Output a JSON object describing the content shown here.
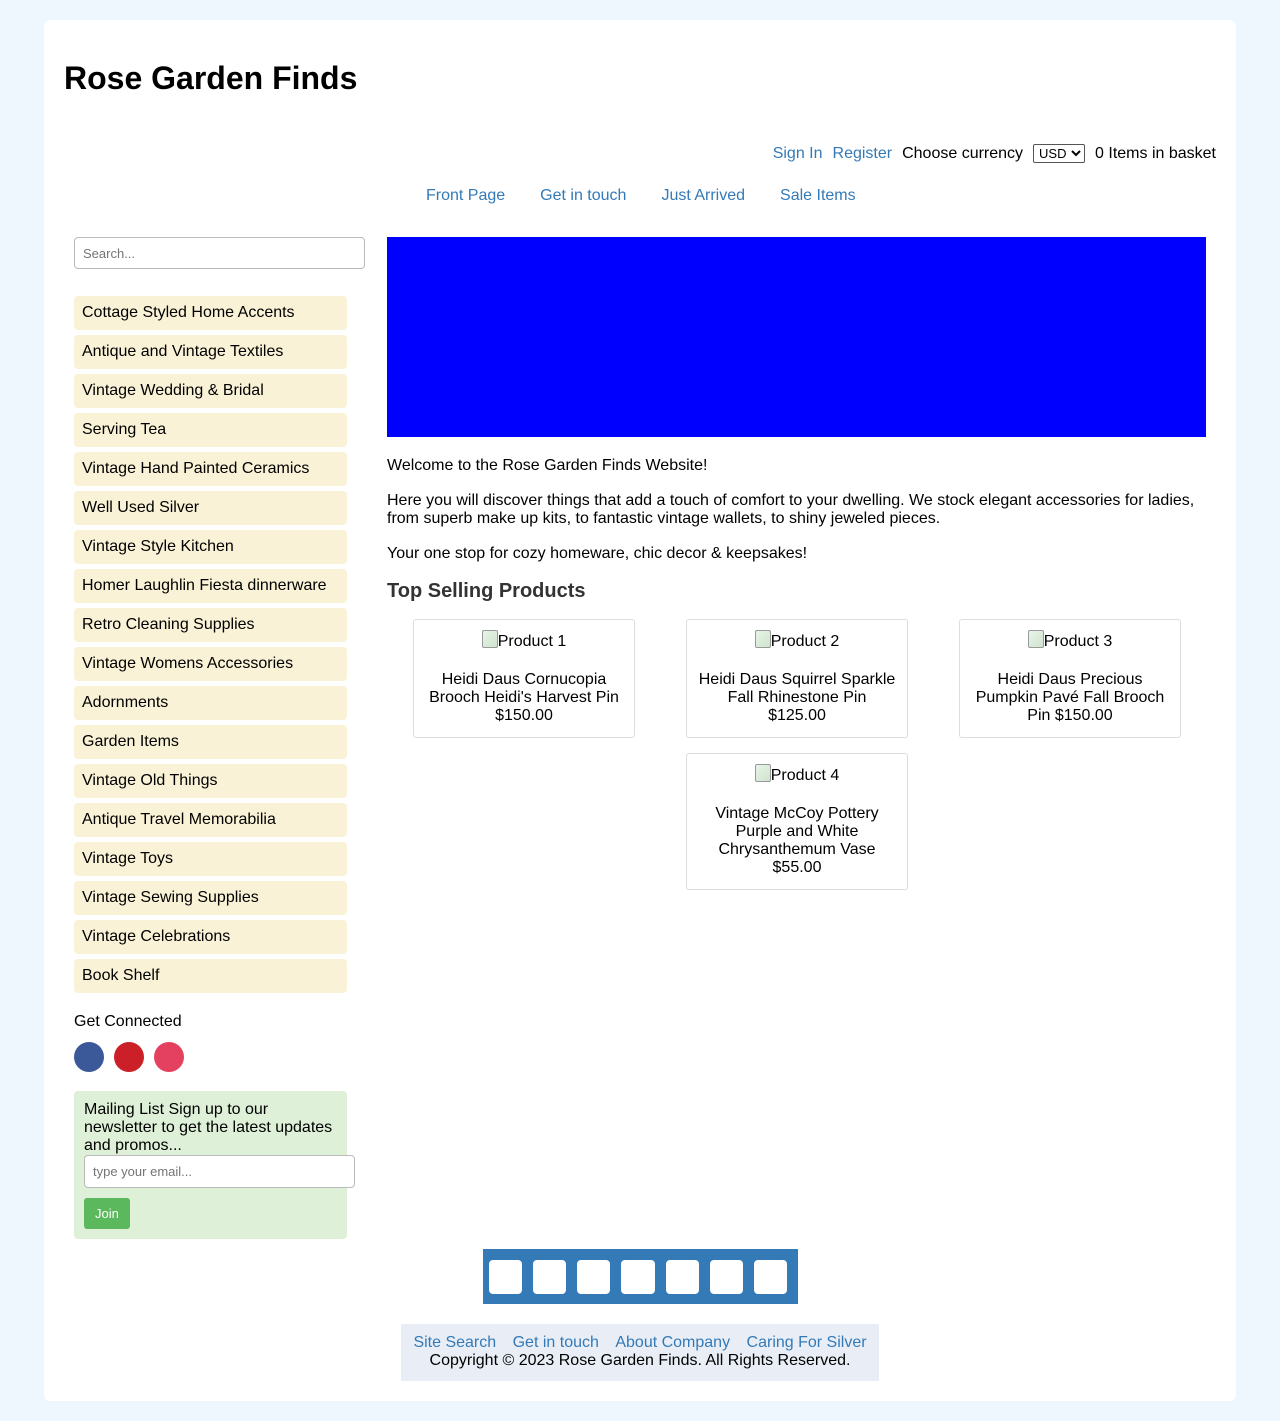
{
  "site": {
    "title": "Rose Garden Finds"
  },
  "topbar": {
    "sign_in": "Sign In",
    "register": "Register",
    "currency_label": "Choose currency",
    "currency_selected": "USD",
    "basket": "0 Items in basket"
  },
  "nav": [
    "Front Page",
    "Get in touch",
    "Just Arrived",
    "Sale Items"
  ],
  "sidebar": {
    "search_placeholder": "Search...",
    "categories": [
      "Cottage Styled Home Accents",
      "Antique and Vintage Textiles",
      "Vintage Wedding & Bridal",
      "Serving Tea",
      "Vintage Hand Painted Ceramics",
      "Well Used Silver",
      "Vintage Style Kitchen",
      "Homer Laughlin Fiesta dinnerware",
      "Retro Cleaning Supplies",
      "Vintage Womens Accessories",
      "Adornments",
      "Garden Items",
      "Vintage Old Things",
      "Antique Travel Memorabilia",
      "Vintage Toys",
      "Vintage Sewing Supplies",
      "Vintage Celebrations",
      "Book Shelf"
    ],
    "get_connected": "Get Connected",
    "social_colors": {
      "facebook": "#3b5998",
      "pinterest": "#cb2027",
      "instagram": "#e4405f"
    },
    "mailing_text": "Mailing List Sign up to our newsletter to get the latest updates and promos...",
    "email_placeholder": "type your email...",
    "join_label": "Join"
  },
  "main": {
    "banner_color": "#0000ff",
    "welcome": "Welcome to the Rose Garden Finds Website!",
    "intro": "Here you will discover things that add a touch of comfort to your dwelling. We stock elegant accessories for ladies, from superb make up kits, to fantastic vintage wallets, to shiny jeweled pieces.",
    "tagline": "Your one stop for cozy homeware, chic decor & keepsakes!",
    "top_selling_heading": "Top Selling Products",
    "products": [
      {
        "image_alt": "Product 1",
        "name": "Heidi Daus Cornucopia Brooch Heidi's Harvest Pin",
        "price": "$150.00"
      },
      {
        "image_alt": "Product 2",
        "name": "Heidi Daus Squirrel Sparkle Fall Rhinestone Pin",
        "price": "$125.00"
      },
      {
        "image_alt": "Product 3",
        "name": "Heidi Daus Precious Pumpkin Pavé Fall Brooch Pin",
        "price": "$150.00"
      },
      {
        "image_alt": "Product 4",
        "name": "Vintage McCoy Pottery Purple and White Chrysanthemum Vase",
        "price": "$55.00"
      }
    ]
  },
  "footer": {
    "links": [
      "Site Search",
      "Get in touch",
      "About Company",
      "Caring For Silver"
    ],
    "copyright": "Copyright © 2023 Rose Garden Finds. All Rights Reserved."
  }
}
